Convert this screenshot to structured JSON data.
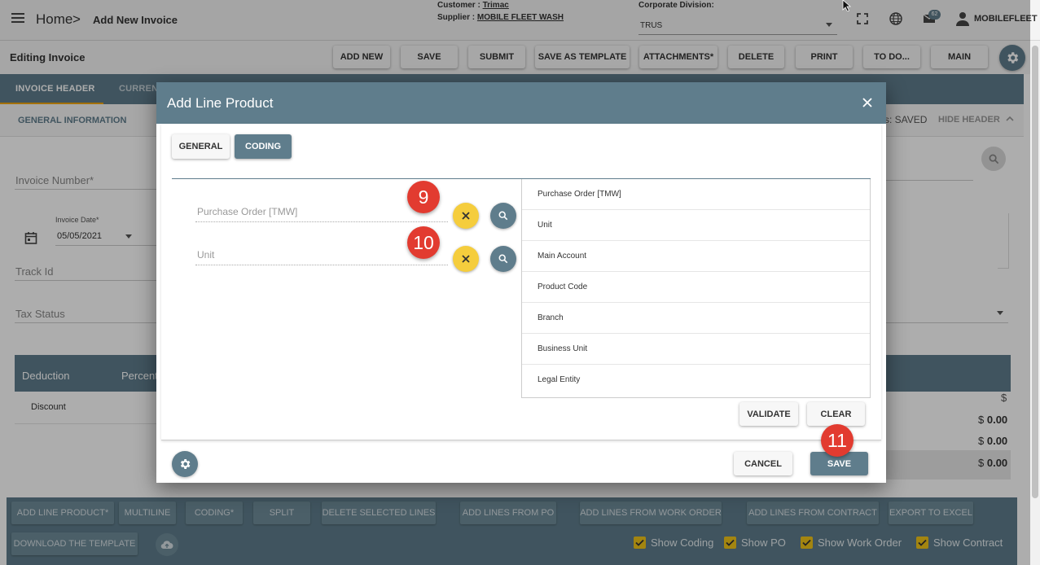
{
  "topbar": {
    "home": "Home",
    "separator": ">",
    "title": "Add New Invoice",
    "customer_label": "Customer :",
    "customer_value": "Trimac",
    "supplier_label": "Supplier :",
    "supplier_value": "MOBILE FLEET WASH",
    "corp_label": "Corporate Division:",
    "corp_value": "TRUS",
    "message_count": "62",
    "user": "MOBILEFLEET"
  },
  "toolbar": {
    "editing_label": "Editing Invoice",
    "buttons": [
      "ADD NEW",
      "SAVE",
      "SUBMIT",
      "SAVE AS TEMPLATE",
      "ATTACHMENTS*",
      "DELETE",
      "PRINT",
      "TO DO...",
      "MAIN"
    ]
  },
  "tabs": {
    "invoice_header": "INVOICE HEADER",
    "current": "CURRENT"
  },
  "subheader": {
    "general_information": "GENERAL INFORMATION",
    "status": "s: SAVED",
    "hide_header": "HIDE HEADER"
  },
  "form": {
    "invoice_number": "Invoice Number*",
    "invoice_date_label": "Invoice Date*",
    "invoice_date_value": "05/05/2021",
    "track_id": "Track Id",
    "tax_status": "Tax Status"
  },
  "deductions": {
    "col_deduction": "Deduction",
    "col_percent": "Percent",
    "row_discount": "Discount"
  },
  "totals": {
    "currency": "$",
    "values": [
      "0.00",
      "0.00",
      "0.00"
    ]
  },
  "bottombar": {
    "buttons": [
      "ADD LINE PRODUCT*",
      "MULTILINE",
      "CODING*",
      "SPLIT",
      "DELETE SELECTED LINES",
      "ADD LINES FROM PO",
      "ADD LINES FROM WORK ORDER",
      "ADD LINES FROM CONTRACT",
      "EXPORT TO EXCEL",
      "DOWNLOAD THE TEMPLATE"
    ],
    "checks": [
      "Show Coding",
      "Show PO",
      "Show Work Order",
      "Show Contract"
    ]
  },
  "modal": {
    "title": "Add Line Product",
    "tab_general": "GENERAL",
    "tab_coding": "CODING",
    "field_po": "Purchase Order [TMW]",
    "field_unit": "Unit",
    "code_list": [
      "Purchase Order [TMW]",
      "Unit",
      "Main Account",
      "Product Code",
      "Branch",
      "Business Unit",
      "Legal Entity"
    ],
    "validate": "VALIDATE",
    "clear": "CLEAR",
    "cancel": "CANCEL",
    "save": "SAVE"
  },
  "steps": [
    "9",
    "10",
    "11"
  ],
  "colors": {
    "slate": "#5f7d8c",
    "yellow": "#f5cd3d",
    "step_red": "#e23b30",
    "tab_accent": "#f0a500"
  }
}
